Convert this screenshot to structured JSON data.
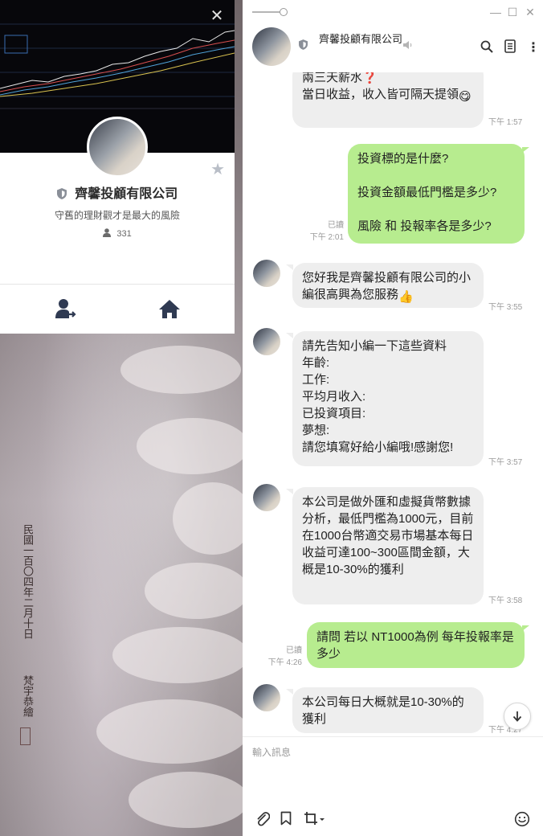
{
  "profile": {
    "close_label": "✕",
    "name": "齊馨投顧有限公司",
    "status_message": "守舊的理財觀才是最大的風險",
    "friend_count": "331"
  },
  "background": {
    "inscription": "民國一百〇四年二月十日",
    "signature": "梵宇恭繪"
  },
  "chat": {
    "title": "齊馨投顧有限公司",
    "window_controls": {
      "minimize": "—",
      "maximize": "☐",
      "close": "✕"
    },
    "messages": [
      {
        "id": "m1",
        "direction": "in",
        "text": "兩三天薪水❓\n當日收益，收入皆可隔天提領",
        "emoji_after": "😋",
        "time": "下午 1:57"
      },
      {
        "id": "m2",
        "direction": "out",
        "text": "投資標的是什麼?\n\n投資金額最低門檻是多少?\n\n風險 和 投報率各是多少?",
        "read": "已讀",
        "time": "下午 2:01"
      },
      {
        "id": "m3",
        "direction": "in",
        "text": "您好我是齊馨投顧有限公司的小編很高興為您服務",
        "emoji_after": "👍",
        "time": "下午 3:55"
      },
      {
        "id": "m4",
        "direction": "in",
        "text": "請先告知小編一下這些資料\n年齡:\n工作:\n平均月收入:\n已投資項目:\n夢想:\n請您填寫好給小編哦!感謝您!",
        "time": "下午 3:57"
      },
      {
        "id": "m5",
        "direction": "in",
        "text": "本公司是做外匯和虛擬貨幣數據分析，最低門檻為1000元，目前在1000台幣適交易市場基本每日收益可達100~300區間金額，大概是10-30%的獲利",
        "time": "下午 3:58"
      },
      {
        "id": "m6",
        "direction": "out",
        "text": "請問 若以 NT1000為例 每年投報率是多少",
        "read": "已讀",
        "time": "下午 4:26"
      },
      {
        "id": "m7",
        "direction": "in",
        "text": "本公司每日大概就是10-30%的獲利",
        "time": "下午 4:27"
      }
    ]
  },
  "composer": {
    "placeholder": "輸入訊息"
  },
  "colors": {
    "outgoing_bubble": "#b7ec8f",
    "incoming_bubble": "#eeeeee",
    "chat_background": "#ffffff"
  },
  "icons": {
    "attach": "paperclip-icon",
    "keep": "bookmark-icon",
    "screenshot": "crop-icon",
    "emoji": "smiley-icon",
    "search": "search-icon",
    "notes": "notes-icon",
    "more": "more-icon",
    "mute": "speaker-muted-icon"
  }
}
